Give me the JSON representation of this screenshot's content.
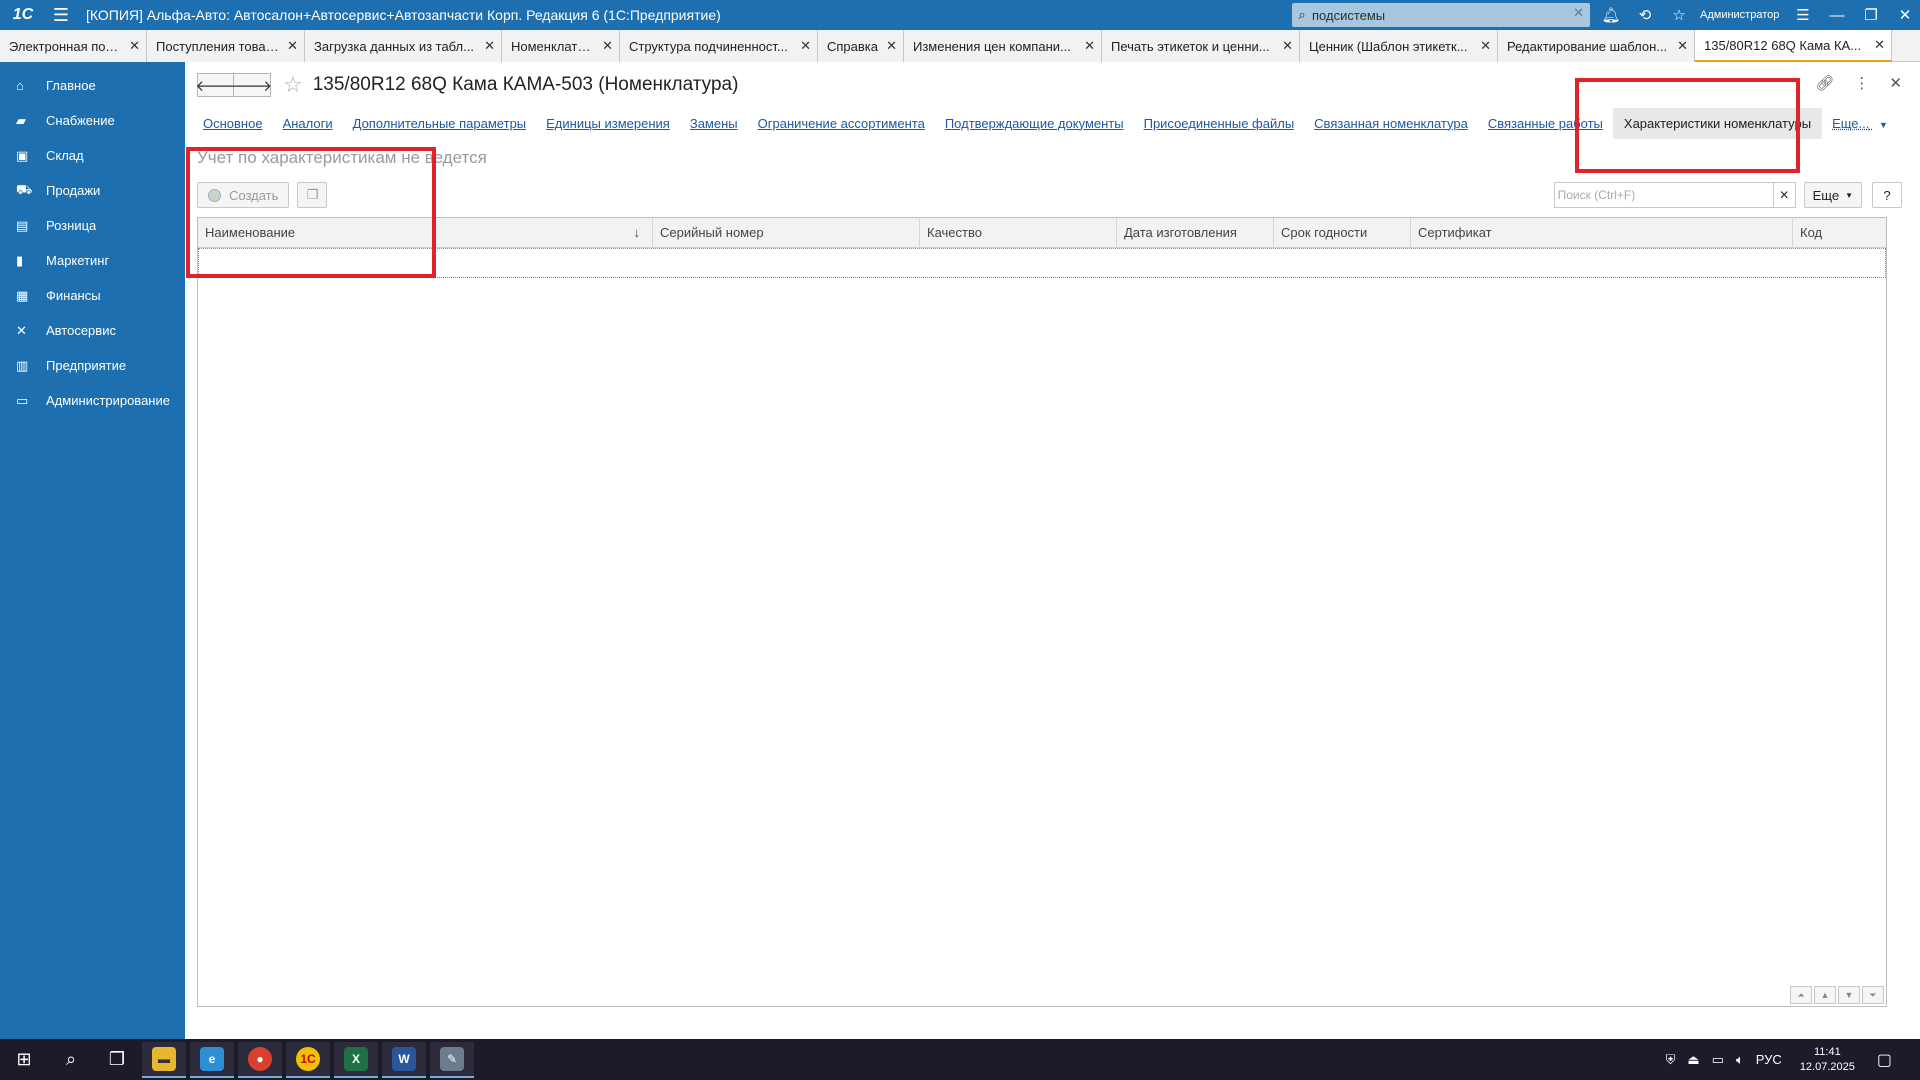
{
  "titlebar": {
    "logo": "1C",
    "title": "[КОПИЯ] Альфа-Авто: Автосалон+Автосервис+Автозапчасти Корп. Редакция 6  (1С:Предприятие)",
    "search_value": "подсистемы",
    "user": "Администратор"
  },
  "tabs": [
    {
      "label": "Электронная почта"
    },
    {
      "label": "Поступления товаров"
    },
    {
      "label": "Загрузка данных из табл..."
    },
    {
      "label": "Номенклатура"
    },
    {
      "label": "Структура подчиненност..."
    },
    {
      "label": "Справка"
    },
    {
      "label": "Изменения цен компани..."
    },
    {
      "label": "Печать этикеток и ценни..."
    },
    {
      "label": "Ценник (Шаблон этикетк..."
    },
    {
      "label": "Редактирование шаблон..."
    },
    {
      "label": "135/80R12 68Q Кама КА..."
    }
  ],
  "sidebar": {
    "items": [
      {
        "label": "Главное",
        "icon": "home-icon"
      },
      {
        "label": "Снабжение",
        "icon": "truck-icon"
      },
      {
        "label": "Склад",
        "icon": "warehouse-icon"
      },
      {
        "label": "Продажи",
        "icon": "cart-icon"
      },
      {
        "label": "Розница",
        "icon": "cash-register-icon"
      },
      {
        "label": "Маркетинг",
        "icon": "bar-chart-icon"
      },
      {
        "label": "Финансы",
        "icon": "money-icon"
      },
      {
        "label": "Автосервис",
        "icon": "wrench-icon"
      },
      {
        "label": "Предприятие",
        "icon": "building-icon"
      },
      {
        "label": "Администрирование",
        "icon": "monitor-icon"
      }
    ]
  },
  "form": {
    "title": "135/80R12 68Q Кама КАМА-503 (Номенклатура)",
    "links": [
      "Основное",
      "Аналоги",
      "Дополнительные параметры",
      "Единицы измерения",
      "Замены",
      "Ограничение ассортимента",
      "Подтверждающие документы",
      "Присоединенные файлы",
      "Связанная номенклатура",
      "Связанные работы",
      "Характеристики номенклатуры"
    ],
    "more_link": "Еще...",
    "note": "Учет по характеристикам не ведется",
    "create_label": "Создать",
    "search_placeholder": "Поиск (Ctrl+F)",
    "more_button": "Еще",
    "help_button": "?"
  },
  "table": {
    "columns": [
      "Наименование",
      "Серийный номер",
      "Качество",
      "Дата изготовления",
      "Срок годности",
      "Сертификат",
      "Код"
    ],
    "sort_indicator": "↓",
    "rows": []
  },
  "taskbar": {
    "lang": "РУС",
    "time": "11:41",
    "date": "12.07.2025"
  },
  "colors": {
    "accent_blue": "#1e6fb0",
    "highlight_red": "#e0232b",
    "link_blue": "#1f58a3",
    "active_tab_underline": "#e6a117"
  }
}
